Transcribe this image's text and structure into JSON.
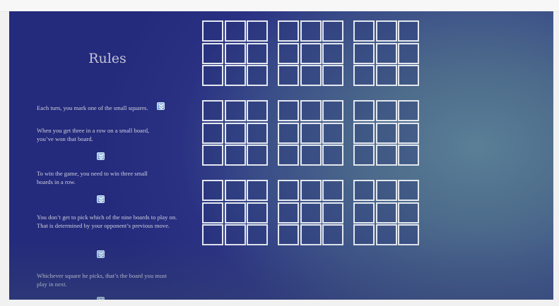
{
  "rules": {
    "title": "Rules",
    "items": [
      "Each turn, you mark one of the small squares.",
      "When you get three in a row on a small board, you’ve won that board.",
      "To win the game, you need to win three small boards in a row.",
      "You don’t get to pick which of the nine boards to play on. That is determined by your opponent’s previous move.",
      "Whichever square he picks, that’s the board you must play in next."
    ],
    "next_icon": "double-chevron-down-icon"
  },
  "game": {
    "boards": 9,
    "cells_per_board": 9,
    "cell_marks": []
  },
  "colors": {
    "background_dark": "#242a7c",
    "background_light": "#5a7f96",
    "grid_line": "#e4e8f0",
    "text": "#cfd0dc",
    "button": "#7fa9d8"
  }
}
